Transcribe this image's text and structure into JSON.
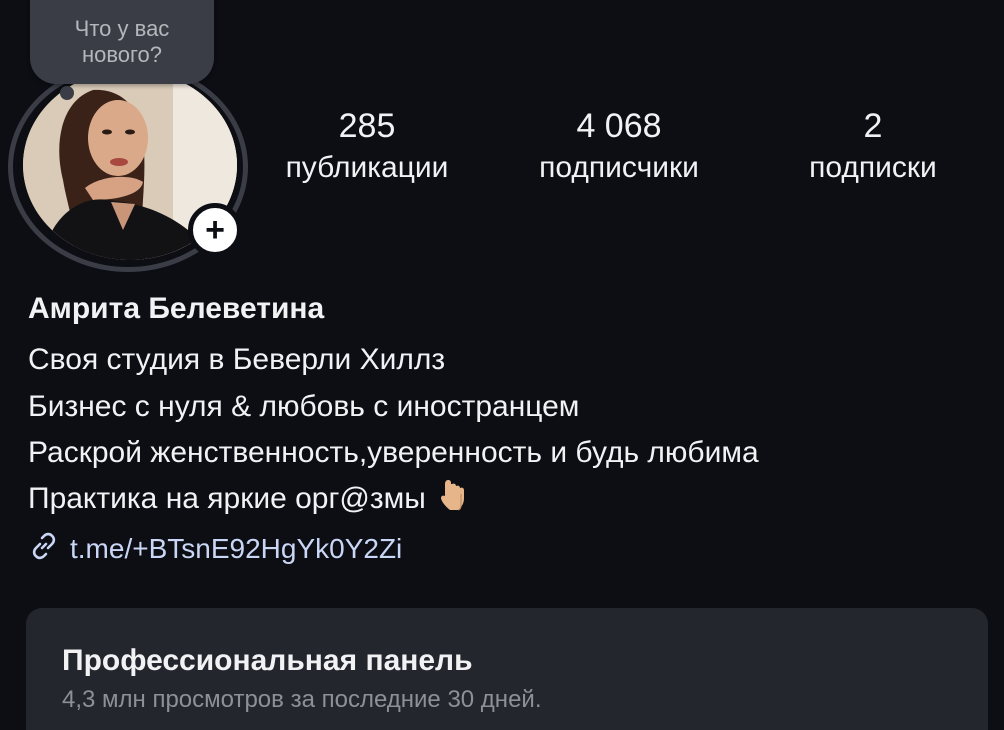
{
  "note": {
    "line1": "Что у вас",
    "line2": "нового?"
  },
  "stats": {
    "posts": {
      "count": "285",
      "label": "публикации"
    },
    "followers": {
      "count": "4 068",
      "label": "подписчики"
    },
    "following": {
      "count": "2",
      "label": "подписки"
    }
  },
  "profile": {
    "name": "Амрита Белеветина",
    "bio": [
      "Своя студия в Беверли Хиллз",
      "Бизнес с нуля & любовь с иностранцем",
      "Раскрой женственность,уверенность и будь любима",
      "Практика на яркие орг@змы"
    ],
    "link": "t.me/+BTsnE92HgYk0Y2Zi",
    "link_icon": "link-chain-icon",
    "emoji": "pointing-down-hand-emoji"
  },
  "professional_dashboard": {
    "title": "Профессиональная панель",
    "subtitle": "4,3 млн просмотров за последние 30 дней."
  },
  "colors": {
    "background": "#0c0e14",
    "card": "#23262d",
    "note_bubble": "#3a3d45",
    "muted_text": "#8e9097",
    "text": "#f2f2f4"
  }
}
